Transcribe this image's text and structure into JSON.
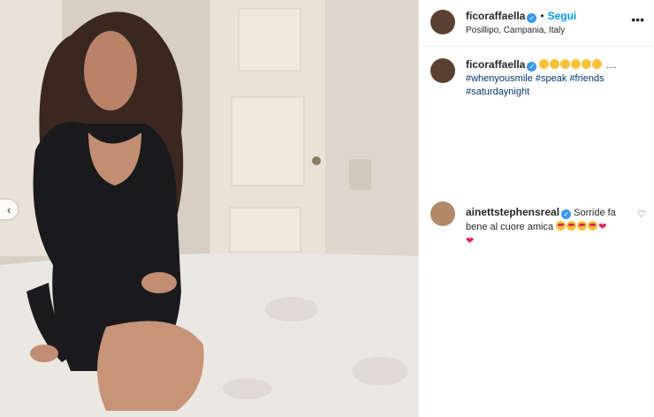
{
  "post": {
    "author": {
      "username": "ficoraffaella",
      "follow_label": "Segui",
      "location": "Posillipo, Campania, Italy",
      "more_icon": "more-horizontal-icon"
    },
    "caption": {
      "username": "ficoraffaella",
      "trailing": "....",
      "hashtags": [
        "#whenyousmile",
        "#speak",
        "#friends",
        "#saturdaynight"
      ]
    },
    "comments": [
      {
        "username": "ainettstephensreal",
        "text": "Sorride fa bene al cuore amica"
      }
    ],
    "carousel": {
      "prev_icon": "chevron-left-icon"
    }
  },
  "colors": {
    "accent": "#0095f6",
    "verified": "#3897f0",
    "hashtag": "#00376b",
    "heart": "#e0245e"
  }
}
